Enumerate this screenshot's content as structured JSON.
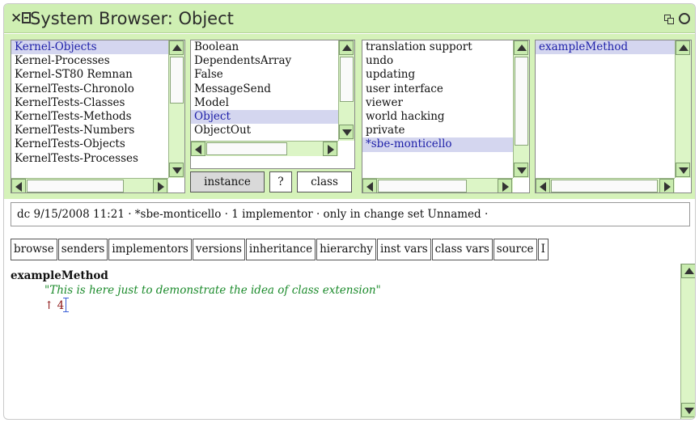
{
  "window": {
    "title": "System Browser: Object"
  },
  "panes": {
    "packages": [
      "Kernel-Objects",
      "Kernel-Processes",
      "Kernel-ST80 Remnan",
      "KernelTests-Chronolo",
      "KernelTests-Classes",
      "KernelTests-Methods",
      "KernelTests-Numbers",
      "KernelTests-Objects",
      "KernelTests-Processes"
    ],
    "classes": [
      "Boolean",
      "DependentsArray",
      "False",
      "MessageSend",
      "Model",
      "Object",
      "ObjectOut"
    ],
    "protocols": [
      "translation support",
      "undo",
      "updating",
      "user interface",
      "viewer",
      "world hacking",
      "private",
      "*sbe-monticello"
    ],
    "methods": [
      "exampleMethod"
    ]
  },
  "class_toggle": {
    "instance": "instance",
    "help": "?",
    "class": "class"
  },
  "info": {
    "text": "dc 9/15/2008 11:21 · *sbe-monticello · 1 implementor · only in change set Unnamed ·"
  },
  "buttons": {
    "browse": "browse",
    "senders": "senders",
    "implementors": "implementors",
    "versions": "versions",
    "inheritance": "inheritance",
    "hierarchy": "hierarchy",
    "inst_vars": "inst vars",
    "class_vars": "class vars",
    "source": "source",
    "more": "I"
  },
  "code": {
    "selector": "exampleMethod",
    "comment": "\"This is here just to demonstrate the idea of class extension\"",
    "return_arrow": "↑",
    "return_value": "4"
  },
  "colors": {
    "titlebar": "#cfefb3",
    "selection": "#d4d6ef",
    "comment": "#1a8a2a"
  }
}
